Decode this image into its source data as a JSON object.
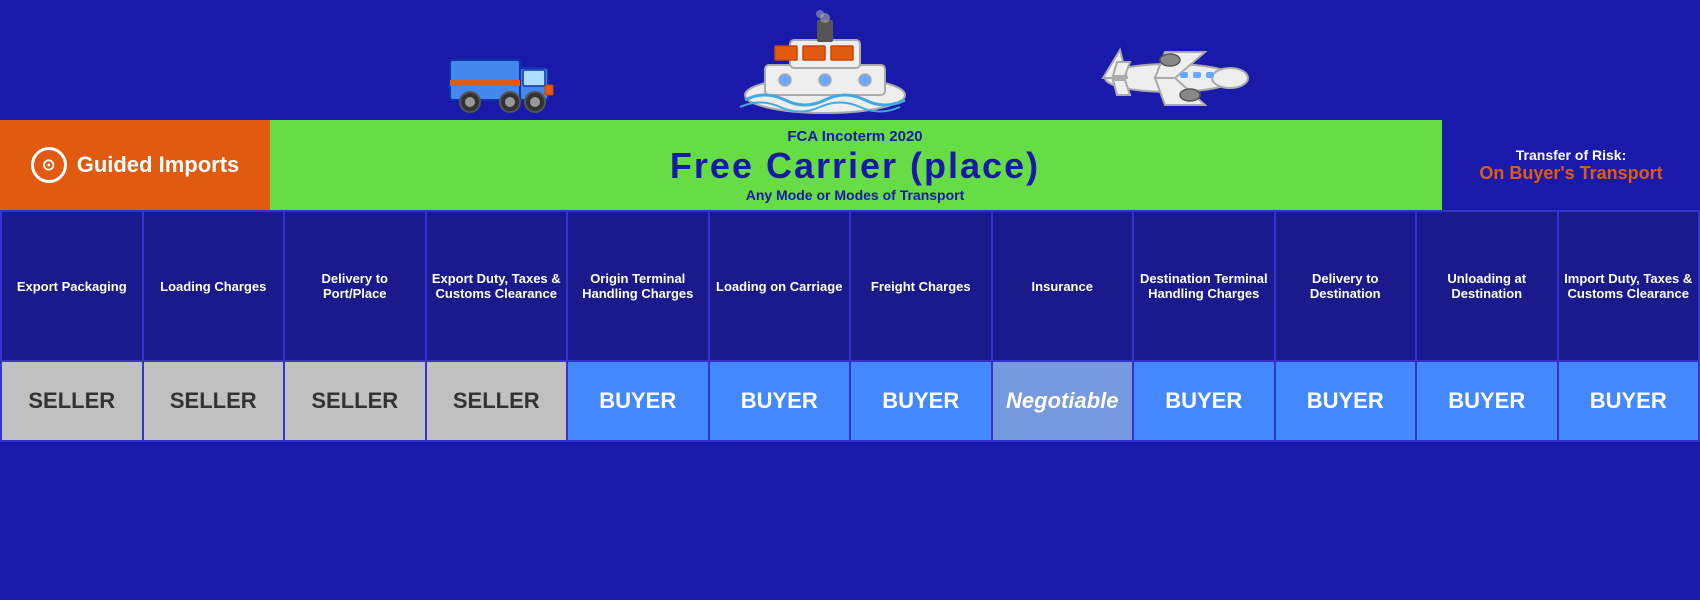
{
  "brand": {
    "name_plain": "Guided",
    "name_bold": "Imports",
    "logo_symbol": "⊙"
  },
  "incoterm": {
    "label": "FCA Incoterm 2020",
    "title": "Free Carrier (place)",
    "subtitle": "Any Mode or Modes of Transport"
  },
  "risk": {
    "label": "Transfer of Risk:",
    "value": "On Buyer's Transport"
  },
  "columns": [
    {
      "id": "export-packaging",
      "header": "Export Packaging",
      "party": "SELLER",
      "type": "seller"
    },
    {
      "id": "loading-charges",
      "header": "Loading Charges",
      "party": "SELLER",
      "type": "seller"
    },
    {
      "id": "delivery-to-port",
      "header": "Delivery to Port/Place",
      "party": "SELLER",
      "type": "seller"
    },
    {
      "id": "export-duty",
      "header": "Export Duty, Taxes & Customs Clearance",
      "party": "SELLER",
      "type": "seller"
    },
    {
      "id": "origin-terminal",
      "header": "Origin Terminal Handling Charges",
      "party": "BUYER",
      "type": "buyer"
    },
    {
      "id": "loading-on-carriage",
      "header": "Loading on Carriage",
      "party": "BUYER",
      "type": "buyer"
    },
    {
      "id": "freight-charges",
      "header": "Freight Charges",
      "party": "BUYER",
      "type": "buyer"
    },
    {
      "id": "insurance",
      "header": "Insurance",
      "party": "Negotiable",
      "type": "negotiable"
    },
    {
      "id": "destination-terminal",
      "header": "Destination Terminal Handling Charges",
      "party": "BUYER",
      "type": "buyer"
    },
    {
      "id": "delivery-to-destination",
      "header": "Delivery to Destination",
      "party": "BUYER",
      "type": "buyer"
    },
    {
      "id": "unloading-at-destination",
      "header": "Unloading at Destination",
      "party": "BUYER",
      "type": "buyer"
    },
    {
      "id": "import-duty",
      "header": "Import Duty, Taxes & Customs Clearance",
      "party": "BUYER",
      "type": "buyer"
    }
  ]
}
